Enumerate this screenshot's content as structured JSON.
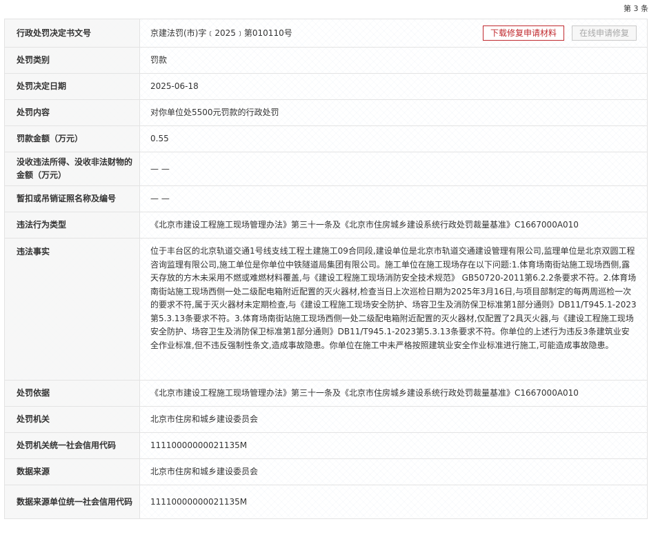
{
  "page_counter": "第 3 条",
  "actions": {
    "download_label": "下载修复申请材料",
    "online_label": "在线申请修复"
  },
  "rows": [
    {
      "label": "行政处罚决定书文号",
      "value": "京建法罚(市)字﹝2025﹞第010110号"
    },
    {
      "label": "处罚类别",
      "value": "罚款"
    },
    {
      "label": "处罚决定日期",
      "value": "2025-06-18"
    },
    {
      "label": "处罚内容",
      "value": "对你单位处5500元罚款的行政处罚"
    },
    {
      "label": "罚款金额（万元）",
      "value": "0.55"
    },
    {
      "label": "没收违法所得、没收非法财物的金额（万元）",
      "value": "— —"
    },
    {
      "label": "暂扣或吊销证照名称及编号",
      "value": "— —"
    },
    {
      "label": "违法行为类型",
      "value": "《北京市建设工程施工现场管理办法》第三十一条及《北京市住房城乡建设系统行政处罚裁量基准》C1667000A010"
    },
    {
      "label": "违法事实",
      "value": "位于丰台区的北京轨道交通1号线支线工程土建施工09合同段,建设单位是北京市轨道交通建设管理有限公司,监理单位是北京双圆工程咨询监理有限公司,施工单位是你单位中铁隧道局集团有限公司。施工单位在施工现场存在以下问题:1.体育场南街站施工现场西侧,露天存放的方木未采用不燃或难燃材料覆盖,与《建设工程施工现场消防安全技术规范》 GB50720-2011第6.2.2条要求不符。2.体育场南街站施工现场西侧一处二级配电箱附近配置的灭火器材,检查当日上次巡检日期为2025年3月16日,与项目部制定的每两周巡检一次的要求不符,属于灭火器材未定期检查,与《建设工程施工现场安全防护、场容卫生及消防保卫标准第1部分通则》DB11/T945.1-2023第5.3.13条要求不符。3.体育场南街站施工现场西侧一处二级配电箱附近配置的灭火器材,仅配置了2具灭火器,与《建设工程施工现场安全防护、场容卫生及消防保卫标准第1部分通则》DB11/T945.1-2023第5.3.13条要求不符。你单位的上述行为违反3条建筑业安全作业标准,但不违反强制性条文,造成事故隐患。你单位在施工中未严格按照建筑业安全作业标准进行施工,可能造成事故隐患。"
    },
    {
      "label": "处罚依据",
      "value": "《北京市建设工程施工现场管理办法》第三十一条及《北京市住房城乡建设系统行政处罚裁量基准》C1667000A010"
    },
    {
      "label": "处罚机关",
      "value": "北京市住房和城乡建设委员会"
    },
    {
      "label": "处罚机关统一社会信用代码",
      "value": "11110000000021135M"
    },
    {
      "label": "数据来源",
      "value": "北京市住房和城乡建设委员会"
    },
    {
      "label": "数据来源单位统一社会信用代码",
      "value": "11110000000021135M"
    }
  ]
}
